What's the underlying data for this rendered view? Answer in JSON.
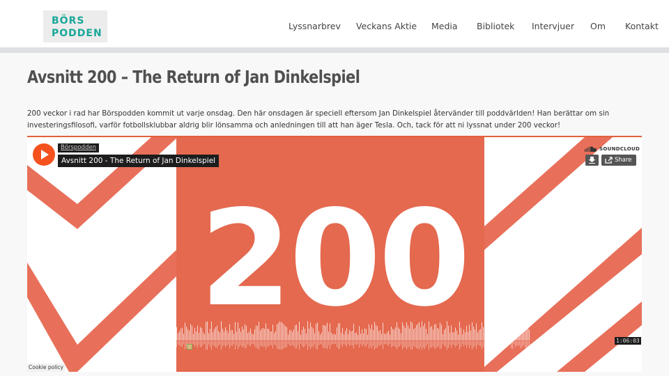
{
  "logo": {
    "line1": "BÖRS",
    "line2": "PODDEN"
  },
  "nav": [
    "Lyssnarbrev",
    "Veckans Aktie",
    "Media",
    "Bibliotek",
    "Intervjuer",
    "Om",
    "Kontakt"
  ],
  "post": {
    "title": "Avsnitt 200 – The Return of Jan Dinkelspiel",
    "description": "200 veckor i rad har Börspodden kommit ut varje onsdag. Den här onsdagen är speciell eftersom Jan Dinkelspiel återvänder till poddvärlden! Han berättar om sin investeringsfilosofi, varför fotbollsklubbar aldrig blir lönsamma och anledningen till att han äger Tesla. Och, tack för att ni lyssnat under 200 veckor!"
  },
  "player": {
    "artist": "Börspodden",
    "track_title": "Avsnitt 200 - The Return of Jan Dinkelspiel",
    "brand": "SOUNDCLOUD",
    "share_label": "Share",
    "duration": "1:06:03",
    "artwork_text": "200",
    "cookie_label": "Cookie policy",
    "icons": [
      "play-icon",
      "soundcloud-logo-icon",
      "download-icon",
      "share-icon"
    ]
  },
  "colors": {
    "accent": "#e2603b",
    "brand_teal": "#1aa79a",
    "play_orange": "#f4511e"
  }
}
